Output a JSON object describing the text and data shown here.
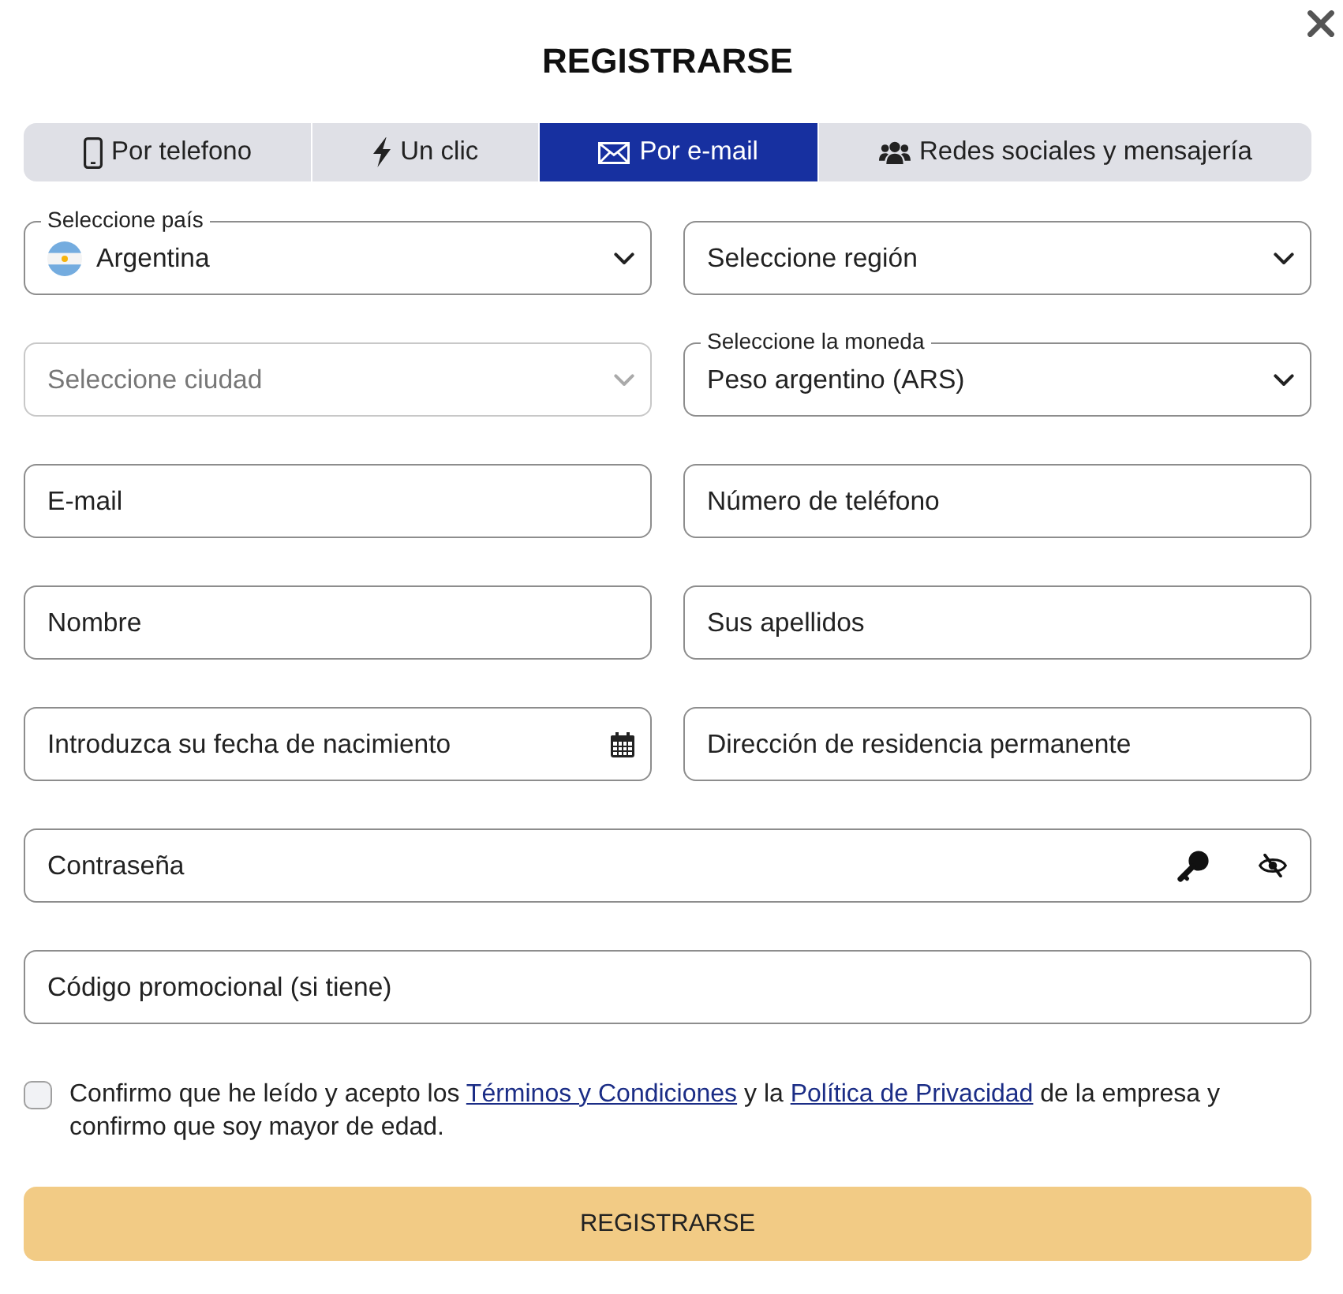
{
  "dialog": {
    "title": "REGISTRARSE"
  },
  "tabs": [
    {
      "label": "Por telefono",
      "selected": false
    },
    {
      "label": "Un clic",
      "selected": false
    },
    {
      "label": "Por e-mail",
      "selected": true
    },
    {
      "label": "Redes sociales y mensajería",
      "selected": false
    }
  ],
  "form_rows": [
    [
      {
        "kind": "country_select",
        "label": "Seleccione país",
        "value": "Argentina",
        "disabled": false
      },
      {
        "kind": "select",
        "placeholder": "Seleccione región",
        "disabled": false
      }
    ],
    [
      {
        "kind": "select",
        "placeholder": "Seleccione ciudad",
        "disabled": true
      },
      {
        "kind": "select",
        "label": "Seleccione la moneda",
        "value": "Peso argentino (ARS)",
        "disabled": false
      }
    ],
    [
      {
        "kind": "text",
        "placeholder": "E-mail",
        "disabled": false
      },
      {
        "kind": "text",
        "placeholder": "Número de teléfono",
        "disabled": false
      }
    ],
    [
      {
        "kind": "text",
        "placeholder": "Nombre",
        "disabled": false
      },
      {
        "kind": "text",
        "placeholder": "Sus apellidos",
        "disabled": false
      }
    ],
    [
      {
        "kind": "date",
        "placeholder": "Introduzca su fecha de nacimiento",
        "disabled": false
      },
      {
        "kind": "text",
        "placeholder": "Dirección de residencia permanente",
        "disabled": false
      }
    ],
    [
      {
        "kind": "password",
        "placeholder": "Contraseña",
        "disabled": false
      }
    ],
    [
      {
        "kind": "text",
        "placeholder": "Código promocional (si tiene)",
        "disabled": false
      }
    ]
  ],
  "consent": {
    "checked": false,
    "parts": [
      {
        "kind": "text",
        "text": "Confirmo que he leído y acepto los "
      },
      {
        "kind": "link",
        "text": "Términos y Condiciones"
      },
      {
        "kind": "text",
        "text": " y la "
      },
      {
        "kind": "link",
        "text": "Política de Privacidad"
      },
      {
        "kind": "text",
        "text": " de la empresa y confirmo que soy mayor de edad."
      }
    ]
  },
  "submit_button": {
    "label": "REGISTRARSE"
  }
}
